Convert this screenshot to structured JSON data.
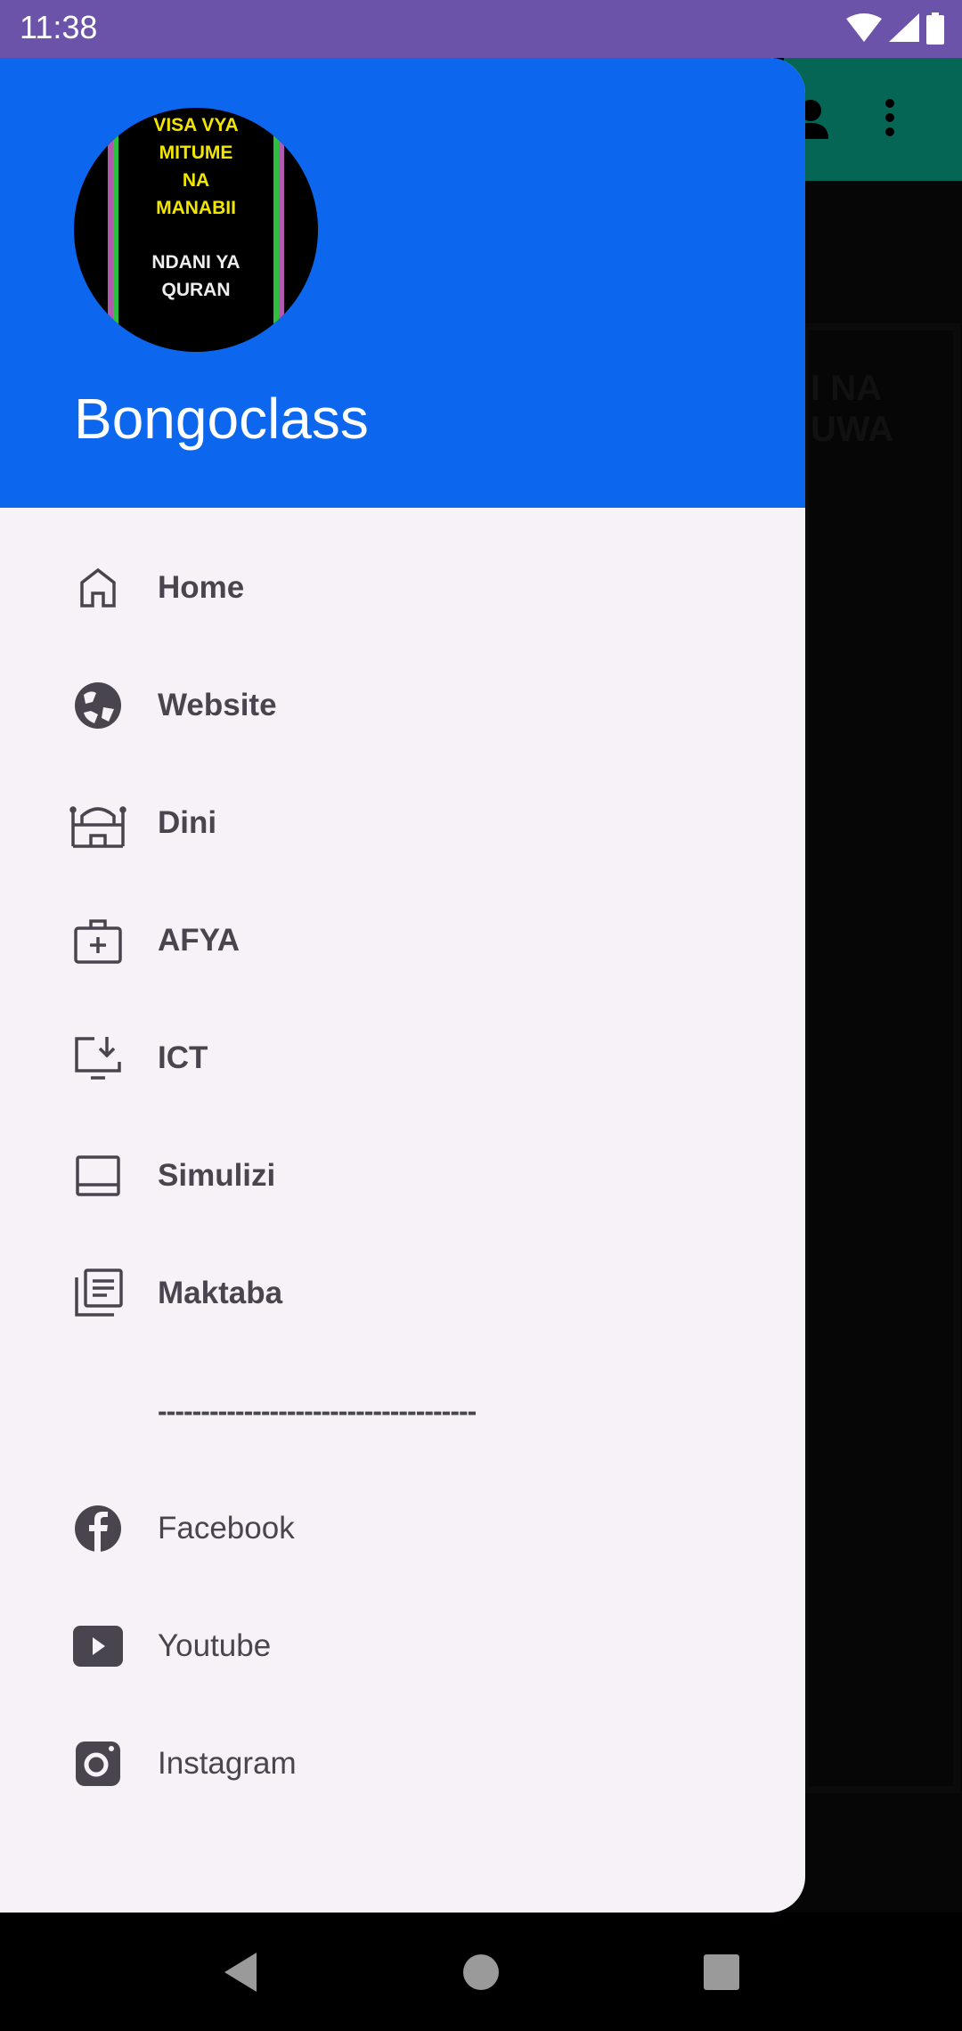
{
  "status_bar": {
    "time": "11:38",
    "icons": [
      "wifi-icon",
      "signal-icon",
      "battery-icon"
    ]
  },
  "background_app": {
    "text_line1": "I NA",
    "text_line2": "UWA",
    "icons": [
      "person-icon",
      "more-vert-icon"
    ],
    "appbar_color": "#056655"
  },
  "drawer": {
    "header": {
      "title": "Bongoclass",
      "color": "#0c67ee",
      "avatar": {
        "line1": "VISA VYA",
        "line2": "MITUME",
        "line3": "NA",
        "line4": "MANABII",
        "line5": "NDANI YA",
        "line6": "QURAN"
      }
    },
    "items": [
      {
        "label": "Home",
        "icon": "home-icon"
      },
      {
        "label": "Website",
        "icon": "globe-icon"
      },
      {
        "label": "Dini",
        "icon": "mosque-icon"
      },
      {
        "label": "AFYA",
        "icon": "medical-kit-icon"
      },
      {
        "label": "ICT",
        "icon": "monitor-download-icon"
      },
      {
        "label": "Simulizi",
        "icon": "laptop-icon"
      },
      {
        "label": "Maktaba",
        "icon": "library-icon"
      }
    ],
    "divider": "-------------------------------------",
    "social": [
      {
        "label": "Facebook",
        "icon": "facebook-icon"
      },
      {
        "label": "Youtube",
        "icon": "youtube-icon"
      },
      {
        "label": "Instagram",
        "icon": "instagram-icon"
      }
    ]
  },
  "nav_bar": {
    "icons": [
      "back-icon",
      "home-circle-icon",
      "recents-icon"
    ]
  }
}
